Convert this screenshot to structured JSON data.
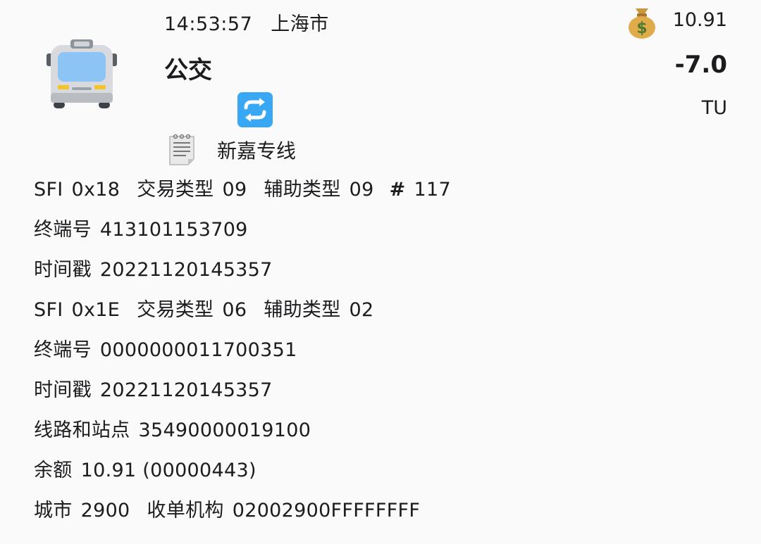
{
  "header": {
    "time": "14:53:57",
    "city": "上海市",
    "balance": "10.91",
    "title": "公交",
    "amount": "-7.0",
    "currency": "TU",
    "line_name": "新嘉专线"
  },
  "icons": {
    "bus": "bus-icon",
    "money": "money-bag-icon",
    "swap": "swap-arrows-icon",
    "memo": "memo-icon"
  },
  "records": [
    {
      "sfi_label": "SFI",
      "sfi": "0x18",
      "tx_type_label": "交易类型",
      "tx_type": "09",
      "aux_type_label": "辅助类型",
      "aux_type": "09",
      "hash_symbol": "#",
      "seq": "117",
      "terminal_label": "终端号",
      "terminal": "413101153709",
      "timestamp_label": "时间戳",
      "timestamp": "20221120145357"
    },
    {
      "sfi_label": "SFI",
      "sfi": "0x1E",
      "tx_type_label": "交易类型",
      "tx_type": "06",
      "aux_type_label": "辅助类型",
      "aux_type": "02",
      "terminal_label": "终端号",
      "terminal": "0000000011700351",
      "timestamp_label": "时间戳",
      "timestamp": "20221120145357"
    }
  ],
  "route_label": "线路和站点",
  "route": "35490000019100",
  "balance_label": "余额",
  "balance_value": "10.91 (00000443)",
  "city_label": "城市",
  "city_code": "2900",
  "acquirer_label": "收单机构",
  "acquirer": "02002900FFFFFFFF",
  "colors": {
    "background": "#fafafb",
    "text": "#1c1c1e",
    "swap_icon": "#39a8f4"
  }
}
